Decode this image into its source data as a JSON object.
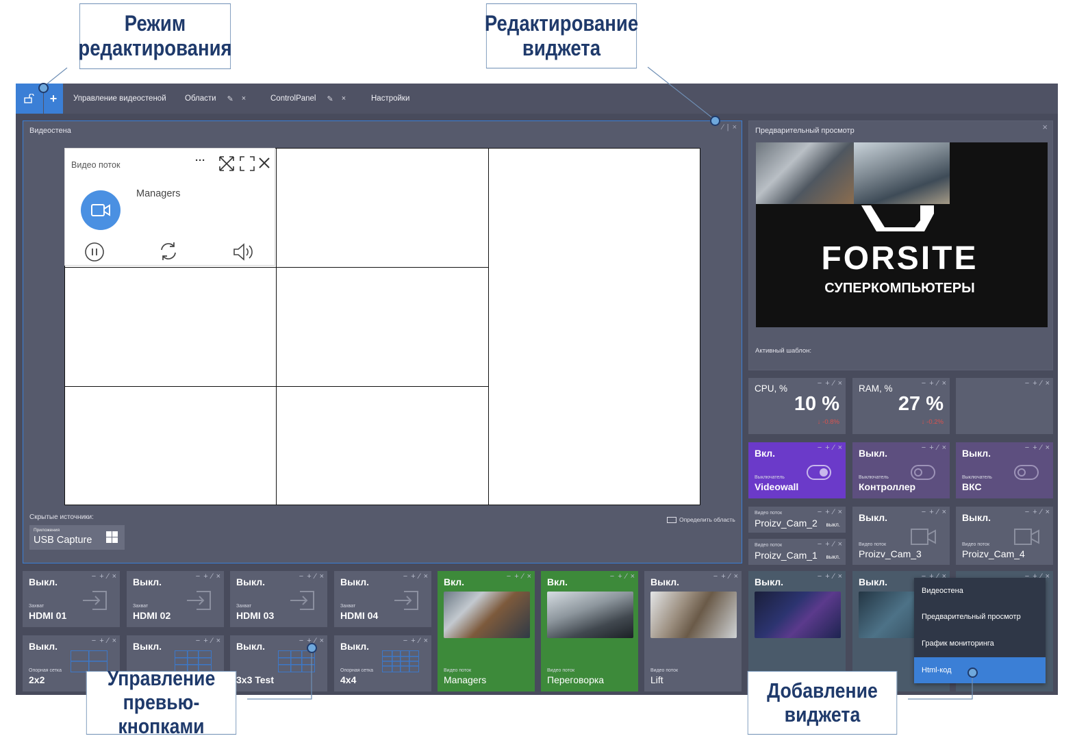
{
  "callouts": {
    "edit_mode_l1": "Режим",
    "edit_mode_l2": "редактирования",
    "widget_edit_l1": "Редактирование",
    "widget_edit_l2": "виджета",
    "preview_buttons_l1": "Управление",
    "preview_buttons_l2": "превью-кнопками",
    "add_widget_l1": "Добавление",
    "add_widget_l2": "виджета"
  },
  "topbar": {
    "lock_icon": "lock-open-icon",
    "add_label": "+",
    "tabs": [
      {
        "label": "Управление видеостеной"
      },
      {
        "label": "Области",
        "edit_icon": "✎",
        "close_icon": "×"
      },
      {
        "label": "ControlPanel",
        "edit_icon": "✎",
        "close_icon": "×"
      },
      {
        "label": "Настройки"
      }
    ]
  },
  "videowall": {
    "title": "Видеостена",
    "controls": "⁄ | ×",
    "hidden_sources_label": "Скрытые источники:",
    "source_sub": "Приложения",
    "source_name": "USB Capture",
    "define_area_label": "Определить область"
  },
  "video_stream": {
    "title": "Видео поток",
    "name": "Managers",
    "menu": "···"
  },
  "preview": {
    "title": "Предварительный просмотр",
    "close": "×",
    "brand": "FORSITE",
    "brand_sub": "СУПЕРКОМПЬЮТЕРЫ",
    "active_template_label": "Активный шаблон:"
  },
  "metrics": [
    {
      "label": "CPU, %",
      "value": "10 %",
      "delta": "-0.8%"
    },
    {
      "label": "RAM, %",
      "value": "27 %",
      "delta": "-0.2%"
    }
  ],
  "tile_controls": "− + ⁄ ×",
  "switches": [
    {
      "state": "Вкл.",
      "sub": "Выключатель",
      "name": "Videowall"
    },
    {
      "state": "Выкл.",
      "sub": "Выключатель",
      "name": "Контроллер"
    },
    {
      "state": "Выкл.",
      "sub": "Выключатель",
      "name": "ВКС"
    }
  ],
  "cams_small": [
    {
      "sub": "Видео поток",
      "name": "Proizv_Cam_2",
      "state": "выкл."
    },
    {
      "sub": "Видео поток",
      "name": "Proizv_Cam_1",
      "state": "выкл."
    }
  ],
  "cams": [
    {
      "state": "Выкл.",
      "sub": "Видео поток",
      "name": "Proizv_Cam_3"
    },
    {
      "state": "Выкл.",
      "sub": "Видео поток",
      "name": "Proizv_Cam_4"
    }
  ],
  "bottom_row1": [
    {
      "state": "Выкл.",
      "sub": "Захват",
      "name": "HDMI 01"
    },
    {
      "state": "Выкл.",
      "sub": "Захват",
      "name": "HDMI 02"
    },
    {
      "state": "Выкл.",
      "sub": "Захват",
      "name": "HDMI 03"
    },
    {
      "state": "Выкл.",
      "sub": "Захват",
      "name": "HDMI 04"
    },
    {
      "state": "Вкл.",
      "sub": "",
      "name": ""
    },
    {
      "state": "Вкл.",
      "sub": "",
      "name": ""
    },
    {
      "state": "Выкл.",
      "sub": "",
      "name": ""
    },
    {
      "state": "Выкл.",
      "sub": "",
      "name": ""
    },
    {
      "state": "Выкл.",
      "sub": "",
      "name": ""
    }
  ],
  "bottom_row2": [
    {
      "state": "Выкл.",
      "sub": "Опорная сетка",
      "name": "2x2"
    },
    {
      "state": "Выкл.",
      "sub": "",
      "name": ""
    },
    {
      "state": "Выкл.",
      "sub": "",
      "name": "3x3 Test"
    },
    {
      "state": "Выкл.",
      "sub": "Опорная сетка",
      "name": "4x4"
    },
    {
      "state": "",
      "sub": "Видео поток",
      "name": "Managers"
    },
    {
      "state": "",
      "sub": "Видео поток",
      "name": "Переговорка"
    },
    {
      "state": "",
      "sub": "Видео поток",
      "name": "Lift"
    }
  ],
  "add_menu": {
    "items": [
      "Видеостена",
      "Предварительный просмотр",
      "График мониторинга",
      "Html-код"
    ]
  },
  "colors": {
    "accent": "#3b7fd6",
    "app_bg": "#484b5c",
    "on_green": "#3d8a3a",
    "on_purple": "#6b3ac9",
    "callout_text": "#1f3a6b",
    "delta_red": "#d9534f"
  }
}
